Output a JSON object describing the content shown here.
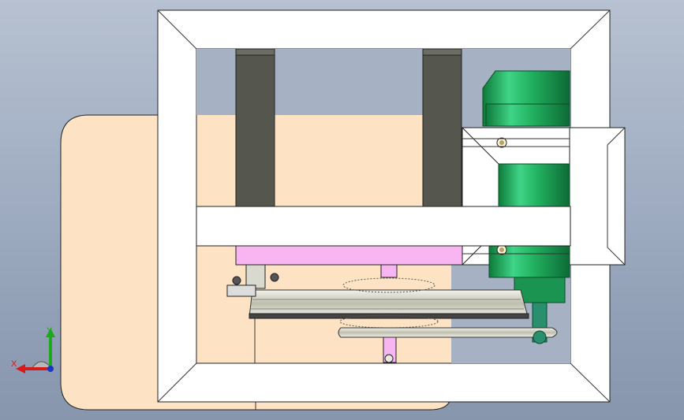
{
  "viewport": {
    "title": "",
    "background": [
      "#b7c1d1",
      "#8795ad"
    ]
  },
  "model": {
    "parts": [
      {
        "name": "base-plate",
        "color": "#fde3c4"
      },
      {
        "name": "square-frame",
        "color": "#ffffff"
      },
      {
        "name": "vertical-column-left",
        "color": "#55564e"
      },
      {
        "name": "vertical-column-right",
        "color": "#55564e"
      },
      {
        "name": "cross-beam",
        "color": "#ffffff"
      },
      {
        "name": "pink-plate",
        "color": "#f7b6f1"
      },
      {
        "name": "motor",
        "color": "#1fa455"
      },
      {
        "name": "motor-mount-bracket",
        "color": "#ffffff"
      },
      {
        "name": "large-pulley",
        "color": "#d8d8cc"
      },
      {
        "name": "spiral-blade-wheel",
        "color": "#6f7478"
      },
      {
        "name": "drive-belt",
        "color": "#d8d8cc"
      },
      {
        "name": "motor-pulley",
        "color": "#2a8f6f"
      }
    ]
  },
  "triad": {
    "x_label": "X",
    "y_label": "Y",
    "x_color": "#d41a1a",
    "y_color": "#1ea81e",
    "z_color": "#1a36c8"
  }
}
